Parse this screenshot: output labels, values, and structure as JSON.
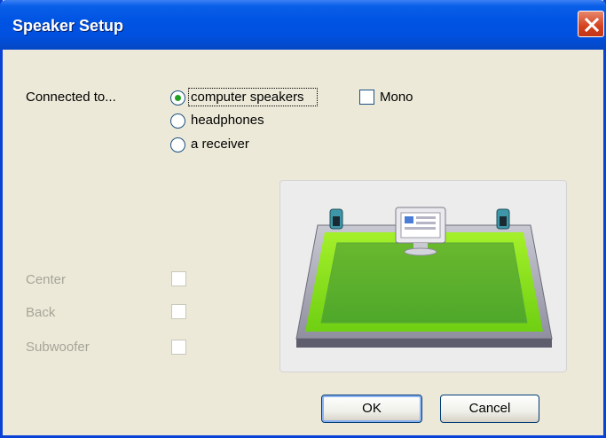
{
  "window": {
    "title": "Speaker Setup"
  },
  "connection": {
    "label": "Connected to...",
    "options": [
      {
        "label": "computer speakers",
        "checked": true
      },
      {
        "label": "headphones",
        "checked": false
      },
      {
        "label": "a receiver",
        "checked": false
      }
    ]
  },
  "mono": {
    "label": "Mono",
    "checked": false
  },
  "extras": [
    {
      "label": "Center",
      "checked": false,
      "enabled": false
    },
    {
      "label": "Back",
      "checked": false,
      "enabled": false
    },
    {
      "label": "Subwoofer",
      "checked": false,
      "enabled": false
    }
  ],
  "buttons": {
    "ok": "OK",
    "cancel": "Cancel"
  },
  "colors": {
    "titlebar": "#0054e3",
    "dialog_bg": "#ece9d8",
    "floor_green": "#7ed321",
    "disabled_text": "#a6a598"
  }
}
